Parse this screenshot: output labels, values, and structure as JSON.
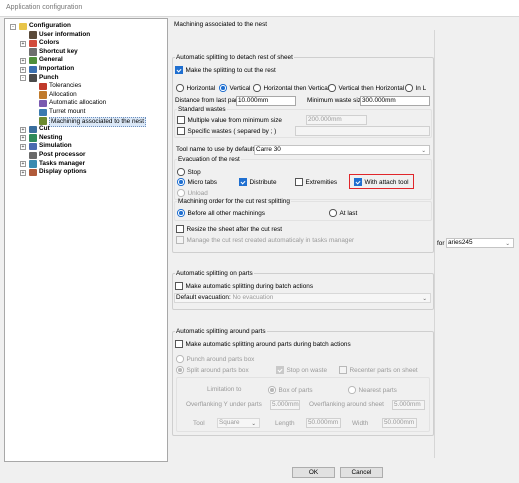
{
  "window": {
    "title": "Application configuration"
  },
  "tree": {
    "items": [
      {
        "label": "Configuration",
        "icon": "folder-icon",
        "color": "#e8c54a",
        "bold": true
      },
      {
        "label": "User information",
        "icon": "user-icon",
        "color": "#5a4a3a",
        "bold": true
      },
      {
        "label": "Colors",
        "icon": "palette-icon",
        "color": "#d24b3c",
        "bold": true
      },
      {
        "label": "Shortcut key",
        "icon": "key-icon",
        "color": "#6e6e6e",
        "bold": true
      },
      {
        "label": "General",
        "icon": "gear-icon",
        "color": "#4f8f3a",
        "bold": true
      },
      {
        "label": "Importation",
        "icon": "import-icon",
        "color": "#3a6fb0",
        "bold": true
      },
      {
        "label": "Punch",
        "icon": "punch-icon",
        "color": "#4a4a4a",
        "bold": true
      },
      {
        "label": "Tolerancies",
        "icon": "tolerance-icon",
        "color": "#c03a2b",
        "bold": false
      },
      {
        "label": "Allocation",
        "icon": "allocation-icon",
        "color": "#c07a2b",
        "bold": false
      },
      {
        "label": "Automatic allocation",
        "icon": "auto-allocation-icon",
        "color": "#7a5ab0",
        "bold": false
      },
      {
        "label": "Turret mount",
        "icon": "turret-icon",
        "color": "#3a7ab0",
        "bold": false
      },
      {
        "label": "Machining associated to the nest",
        "icon": "machining-icon",
        "color": "#6b8a2e",
        "bold": false
      },
      {
        "label": "Cut",
        "icon": "cut-icon",
        "color": "#3a6e9e",
        "bold": true
      },
      {
        "label": "Nesting",
        "icon": "nesting-icon",
        "color": "#2e8a5a",
        "bold": true
      },
      {
        "label": "Simulation",
        "icon": "simulation-icon",
        "color": "#4a6ab0",
        "bold": true
      },
      {
        "label": "Post processor",
        "icon": "post-processor-icon",
        "color": "#6a6a6a",
        "bold": true
      },
      {
        "label": "Tasks manager",
        "icon": "tasks-icon",
        "color": "#3a8ab0",
        "bold": true
      },
      {
        "label": "Display options",
        "icon": "display-icon",
        "color": "#b05a3a",
        "bold": true
      }
    ]
  },
  "panel": {
    "title": "Machining associated to the nest",
    "rest": {
      "legend": "Automatic splitting to detach rest of sheet",
      "make_label": "Make the splitting to cut the rest",
      "orientation": [
        "Horizontal",
        "Vertical",
        "Horizontal then Vertical",
        "Vertical then Horizontal",
        "In L"
      ],
      "distance_label": "Distance from last part",
      "distance_value": "10.000mm",
      "min_waste_label": "Minimum waste size",
      "min_waste_value": "300.000mm",
      "standard_wastes_legend": "Standard wastes",
      "multiple_label": "Multiple value from minimum size",
      "multiple_value": "200.000mm",
      "specific_label": "Specific wastes ( separed by ; )",
      "tool_label": "Tool name to use by default",
      "tool_value": "Carre 30",
      "evac_legend": "Evacuation of the rest",
      "stop_label": "Stop",
      "micro_tabs_label": "Micro tabs",
      "distribute_label": "Distribute",
      "extremities_label": "Extremities",
      "attach_tool_label": "With attach tool",
      "unload_label": "Unload",
      "order_legend": "Machining order for the cut rest splitting",
      "before_label": "Before all other machinings",
      "at_last_label": "At last",
      "resize_label": "Resize the sheet after the cut rest",
      "manage_label": "Manage the cut rest created automaticaly in tasks manager"
    },
    "machine": {
      "for_label": "for",
      "value": "aries245"
    },
    "on_parts": {
      "legend": "Automatic splitting on parts",
      "make_label": "Make automatic splitting during batch actions",
      "default_evac_label": "Default evacuation",
      "default_evac_value": "No evacuation"
    },
    "around": {
      "legend": "Automatic splitting around parts",
      "make_label": "Make automatic splitting around parts during batch actions",
      "punch_box_label": "Punch around parts box",
      "split_box_label": "Split around parts box",
      "stop_waste_label": "Stop on waste",
      "recenter_label": "Recenter parts on sheet",
      "limitation_label": "Limitation to",
      "box_parts_label": "Box of parts",
      "nearest_label": "Nearest parts",
      "overflank_y_label": "Overflanking Y under parts",
      "overflank_y_value": "5.000mm",
      "overflank_sheet_label": "Overflanking around sheet",
      "overflank_sheet_value": "5.000mm",
      "tool_label": "Tool",
      "tool_value": "Square",
      "length_label": "Length",
      "length_value": "50.000mm",
      "width_label": "Width",
      "width_value": "50.000mm"
    }
  },
  "footer": {
    "ok_label": "OK",
    "cancel_label": "Cancel"
  },
  "colors": {
    "accent": "#1f6fd0",
    "highlight": "#e0262b"
  }
}
